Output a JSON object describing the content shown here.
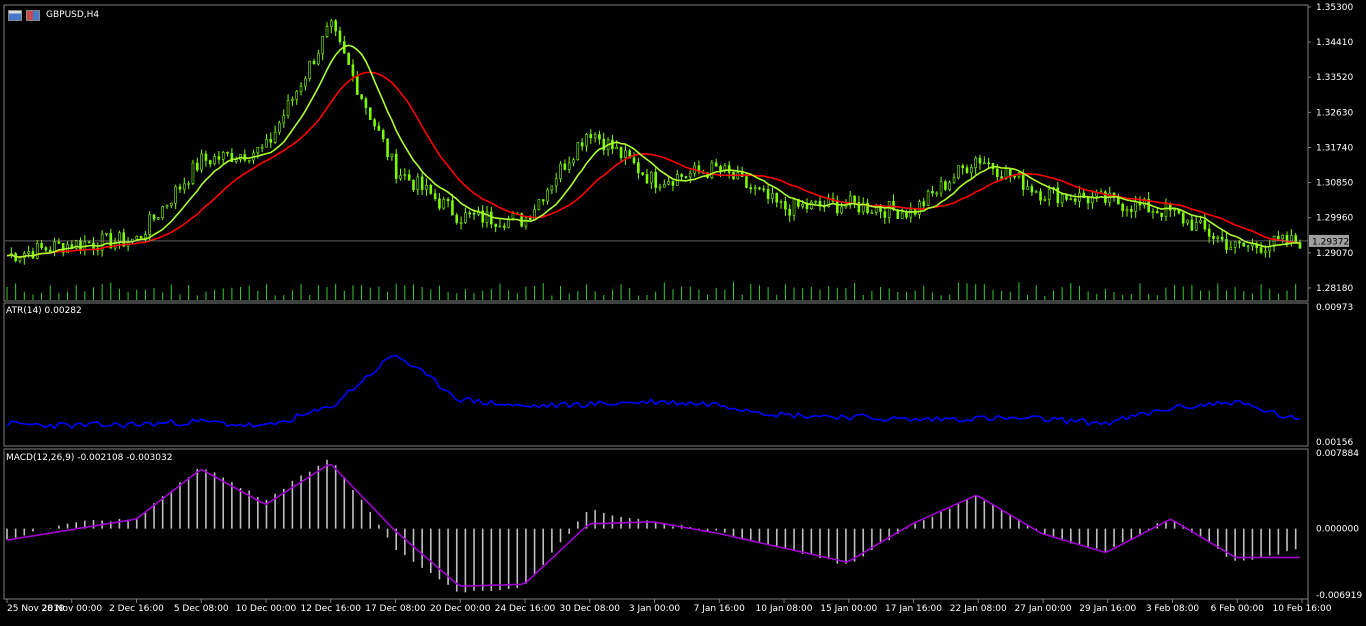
{
  "window": {
    "symbol_label": "GBPUSD,H4"
  },
  "indicators": {
    "atr_label": "ATR(14) 0.00282",
    "macd_label": "MACD(12,26,9) -0.002108 -0.003032"
  },
  "price_axis": {
    "ticks": [
      "1.35300",
      "1.34410",
      "1.33520",
      "1.32630",
      "1.31740",
      "1.30850",
      "1.29960",
      "1.29070",
      "1.28180"
    ],
    "current_price": "1.29372"
  },
  "atr_axis": {
    "ticks": [
      "0.00973",
      "0.00156"
    ]
  },
  "macd_axis": {
    "ticks": [
      "0.007884",
      "0.000000",
      "-0.006919"
    ]
  },
  "time_axis": {
    "labels": [
      "25 Nov 2019",
      "28 Nov 00:00",
      "2 Dec 16:00",
      "5 Dec 08:00",
      "10 Dec 00:00",
      "12 Dec 16:00",
      "17 Dec 08:00",
      "20 Dec 00:00",
      "24 Dec 16:00",
      "30 Dec 08:00",
      "3 Jan 00:00",
      "7 Jan 16:00",
      "10 Jan 08:00",
      "15 Jan 00:00",
      "17 Jan 16:00",
      "22 Jan 08:00",
      "27 Jan 00:00",
      "29 Jan 16:00",
      "3 Feb 08:00",
      "6 Feb 00:00",
      "10 Feb 16:00"
    ]
  },
  "colors": {
    "background": "#000000",
    "candle": "#7CFC00",
    "ma_fast": "#ADFF2F",
    "ma_slow": "#FF0000",
    "atr": "#0000FF",
    "macd_hist": "#C0C0C0",
    "macd_signal": "#A000D0",
    "volume": "#32CD32",
    "grid": "#FFFFFF"
  },
  "chart_data": [
    {
      "type": "candlestick",
      "symbol": "GBPUSD",
      "timeframe": "H4",
      "ylim": [
        1.2785,
        1.3535
      ],
      "current_price": 1.29372,
      "close_path": [
        [
          "25 Nov 2019",
          1.29
        ],
        [
          "28 Nov 00:00",
          1.293
        ],
        [
          "2 Dec 16:00",
          1.294
        ],
        [
          "5 Dec 08:00",
          1.314
        ],
        [
          "10 Dec 00:00",
          1.317
        ],
        [
          "12 Dec 16:00",
          1.348
        ],
        [
          "17 Dec 08:00",
          1.312
        ],
        [
          "20 Dec 00:00",
          1.3
        ],
        [
          "24 Dec 16:00",
          1.299
        ],
        [
          "30 Dec 08:00",
          1.322
        ],
        [
          "3 Jan 00:00",
          1.309
        ],
        [
          "7 Jan 16:00",
          1.312
        ],
        [
          "10 Jan 08:00",
          1.302
        ],
        [
          "15 Jan 00:00",
          1.303
        ],
        [
          "17 Jan 16:00",
          1.301
        ],
        [
          "22 Jan 08:00",
          1.315
        ],
        [
          "27 Jan 00:00",
          1.306
        ],
        [
          "29 Jan 16:00",
          1.304
        ],
        [
          "3 Feb 08:00",
          1.301
        ],
        [
          "6 Feb 00:00",
          1.292
        ],
        [
          "10 Feb 16:00",
          1.2937
        ]
      ]
    },
    {
      "type": "line",
      "name": "ATR(14)",
      "ylim": [
        0.00156,
        0.00973
      ],
      "x": [
        "25 Nov 2019",
        "28 Nov 00:00",
        "2 Dec 16:00",
        "5 Dec 08:00",
        "10 Dec 00:00",
        "12 Dec 16:00",
        "17 Dec 08:00",
        "20 Dec 00:00",
        "24 Dec 16:00",
        "30 Dec 08:00",
        "3 Jan 00:00",
        "7 Jan 16:00",
        "10 Jan 08:00",
        "15 Jan 00:00",
        "17 Jan 16:00",
        "22 Jan 08:00",
        "27 Jan 00:00",
        "29 Jan 16:00",
        "3 Feb 08:00",
        "6 Feb 00:00",
        "10 Feb 16:00"
      ],
      "values": [
        0.00265,
        0.00255,
        0.00262,
        0.0028,
        0.00248,
        0.00365,
        0.0069,
        0.00415,
        0.0037,
        0.00385,
        0.004,
        0.00385,
        0.0032,
        0.0031,
        0.0029,
        0.003,
        0.00295,
        0.0027,
        0.0036,
        0.004,
        0.00282
      ]
    },
    {
      "type": "bar",
      "name": "MACD(12,26,9)",
      "ylim": [
        -0.006919,
        0.007884
      ],
      "x": [
        "25 Nov 2019",
        "28 Nov 00:00",
        "2 Dec 16:00",
        "5 Dec 08:00",
        "10 Dec 00:00",
        "12 Dec 16:00",
        "17 Dec 08:00",
        "20 Dec 00:00",
        "24 Dec 16:00",
        "30 Dec 08:00",
        "3 Jan 00:00",
        "7 Jan 16:00",
        "10 Jan 08:00",
        "15 Jan 00:00",
        "17 Jan 16:00",
        "22 Jan 08:00",
        "27 Jan 00:00",
        "29 Jan 16:00",
        "3 Feb 08:00",
        "6 Feb 00:00",
        "10 Feb 16:00"
      ],
      "histogram": [
        -0.0011,
        0.0007,
        0.001,
        0.0065,
        0.003,
        0.0075,
        -0.002,
        -0.0068,
        -0.006,
        0.002,
        0.0006,
        -0.0003,
        -0.002,
        -0.0038,
        0.0004,
        0.0035,
        -0.0005,
        -0.0025,
        0.0012,
        -0.0035,
        -0.0021
      ],
      "signal": [
        -0.0012,
        -0.0001,
        0.001,
        0.0062,
        0.0025,
        0.0068,
        -0.0002,
        -0.006,
        -0.0058,
        0.0005,
        0.0007,
        -0.0005,
        -0.002,
        -0.0035,
        0.0005,
        0.0035,
        -0.0005,
        -0.0025,
        0.001,
        -0.003,
        -0.003
      ],
      "last_values": [
        -0.002108,
        -0.003032
      ]
    }
  ]
}
